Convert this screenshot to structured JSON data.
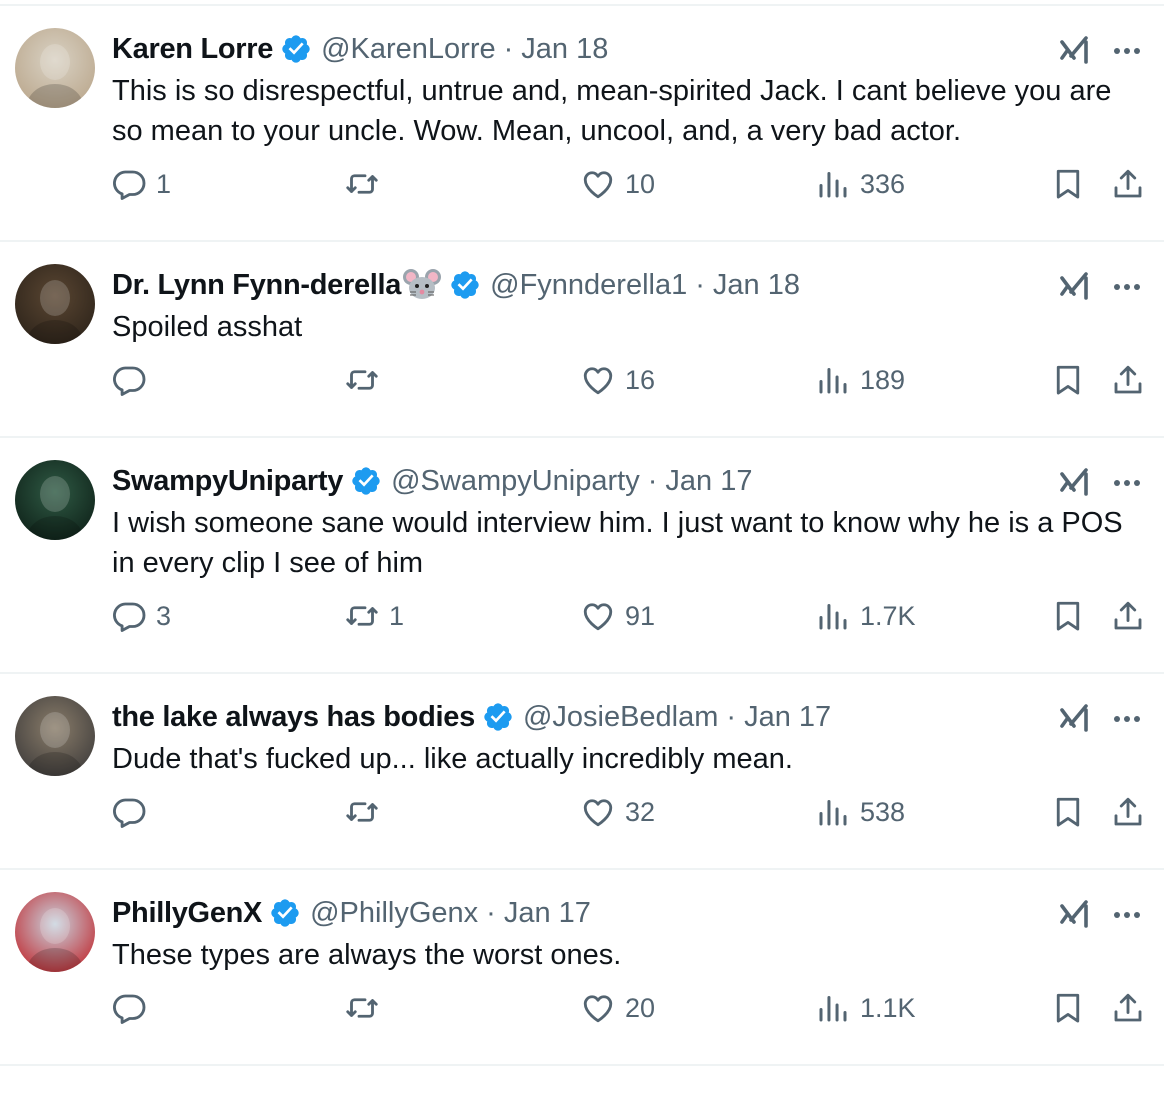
{
  "tweets": [
    {
      "name": "Karen Lorre",
      "name_emoji": "",
      "handle": "@KarenLorre",
      "separator": "·",
      "date": "Jan 18",
      "text": "This is so disrespectful, untrue and, mean-spirited Jack. I cant believe you are so mean to your uncle. Wow. Mean, uncool, and, a very bad actor.",
      "replies": "1",
      "retweets": "",
      "likes": "10",
      "views": "336",
      "avatar_colors": [
        "#d9d2c4",
        "#b9a58a"
      ]
    },
    {
      "name": "Dr. Lynn Fynn-derella",
      "name_emoji": "mouse-face-emoji",
      "handle": "@Fynnderella1",
      "separator": "·",
      "date": "Jan 18",
      "text": "Spoiled asshat",
      "replies": "",
      "retweets": "",
      "likes": "16",
      "views": "189",
      "avatar_colors": [
        "#5a4632",
        "#2b2219"
      ]
    },
    {
      "name": "SwampyUniparty",
      "name_emoji": "",
      "handle": "@SwampyUniparty",
      "separator": "·",
      "date": "Jan 17",
      "text": "I wish someone sane would interview him. I just want to know why he is a POS in every clip I see of him",
      "replies": "3",
      "retweets": "1",
      "likes": "91",
      "views": "1.7K",
      "avatar_colors": [
        "#2f5a44",
        "#0d1f17"
      ]
    },
    {
      "name": "the lake always has bodies",
      "name_emoji": "",
      "handle": "@JosieBedlam",
      "separator": "·",
      "date": "Jan 17",
      "text": "Dude that's fucked up... like actually incredibly mean.",
      "replies": "",
      "retweets": "",
      "likes": "32",
      "views": "538",
      "avatar_colors": [
        "#8a7d6a",
        "#3c3a3a"
      ]
    },
    {
      "name": "PhillyGenX",
      "name_emoji": "",
      "handle": "@PhillyGenx",
      "separator": "·",
      "date": "Jan 17",
      "text": "These types are always the worst ones.",
      "replies": "",
      "retweets": "",
      "likes": "20",
      "views": "1.1K",
      "avatar_colors": [
        "#c8d4df",
        "#c0262c"
      ]
    }
  ],
  "icons": {
    "verified": "verified-badge-icon",
    "grok": "grok-icon",
    "more": "more-icon",
    "reply": "reply-icon",
    "retweet": "retweet-icon",
    "like": "like-icon",
    "views": "views-icon",
    "bookmark": "bookmark-icon",
    "share": "share-icon"
  },
  "colors": {
    "text": "#0f1419",
    "secondary": "#536471",
    "verified": "#1d9bf0",
    "divider": "#eff3f4"
  }
}
